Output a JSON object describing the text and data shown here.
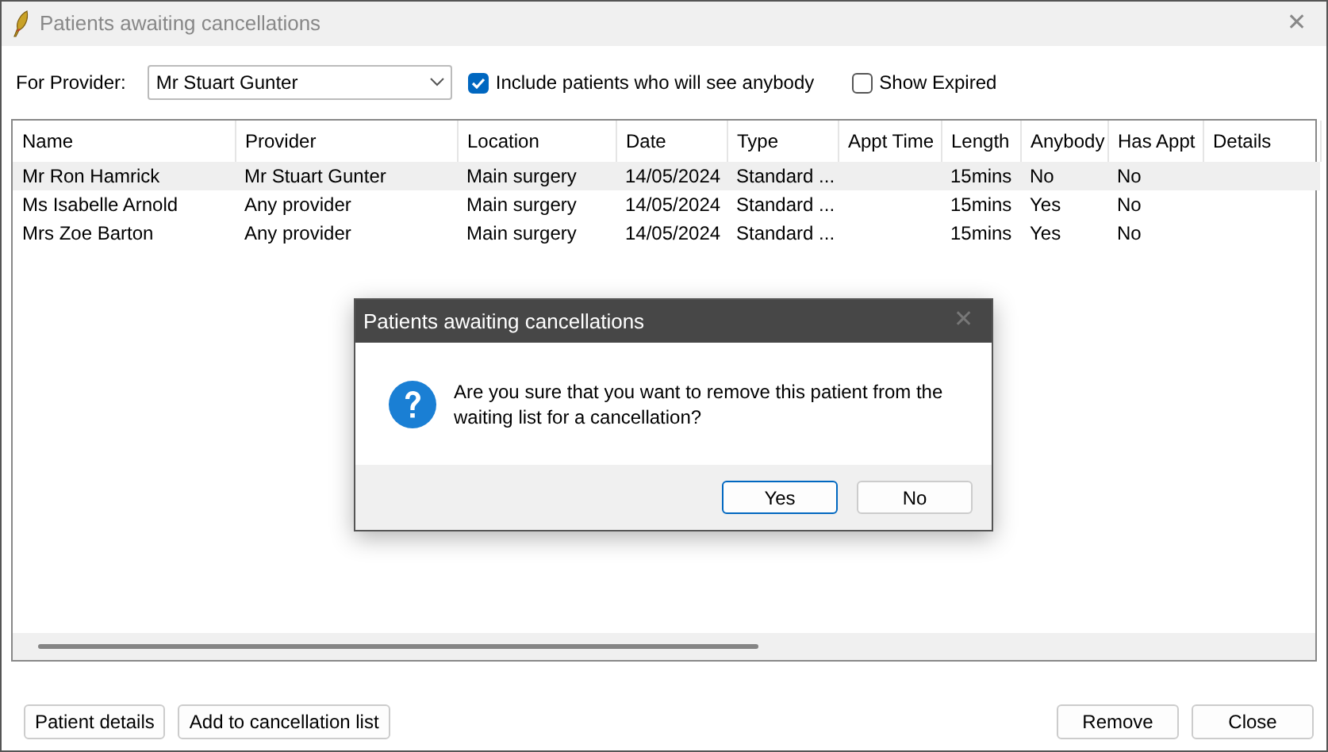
{
  "window": {
    "title": "Patients awaiting cancellations",
    "close": "✕"
  },
  "filters": {
    "provider_label": "For Provider:",
    "provider": "Mr Stuart Gunter",
    "checkboxes": [
      {
        "label": "Include patients who will see anybody",
        "checked": true
      },
      {
        "label": "Show Expired",
        "checked": false
      }
    ]
  },
  "table": {
    "columns": [
      "Name",
      "Provider",
      "Location",
      "Date",
      "Type",
      "Appt Time",
      "Length",
      "Anybody",
      "Has Appt",
      "Details"
    ],
    "rows": [
      {
        "selected": true,
        "cells": [
          "Mr Ron Hamrick",
          "Mr Stuart Gunter",
          "Main surgery",
          "14/05/2024",
          "Standard ...",
          "",
          "15mins",
          "No",
          "No",
          ""
        ]
      },
      {
        "selected": false,
        "cells": [
          "Ms Isabelle Arnold",
          "Any provider",
          "Main surgery",
          "14/05/2024",
          "Standard ...",
          "",
          "15mins",
          "Yes",
          "No",
          ""
        ]
      },
      {
        "selected": false,
        "cells": [
          "Mrs Zoe Barton",
          "Any provider",
          "Main surgery",
          "14/05/2024",
          "Standard ...",
          "",
          "15mins",
          "Yes",
          "No",
          ""
        ]
      }
    ]
  },
  "buttons_left": [
    "Patient details",
    "Add to cancellation list"
  ],
  "buttons_right": [
    "Remove",
    "Close"
  ],
  "dialog": {
    "title": "Patients awaiting cancellations",
    "close": "✕",
    "message": "Are you sure that you want to remove this patient from the waiting list for a cancellation?",
    "buttons": [
      {
        "label": "Yes",
        "default": true
      },
      {
        "label": "No",
        "default": false
      }
    ]
  }
}
